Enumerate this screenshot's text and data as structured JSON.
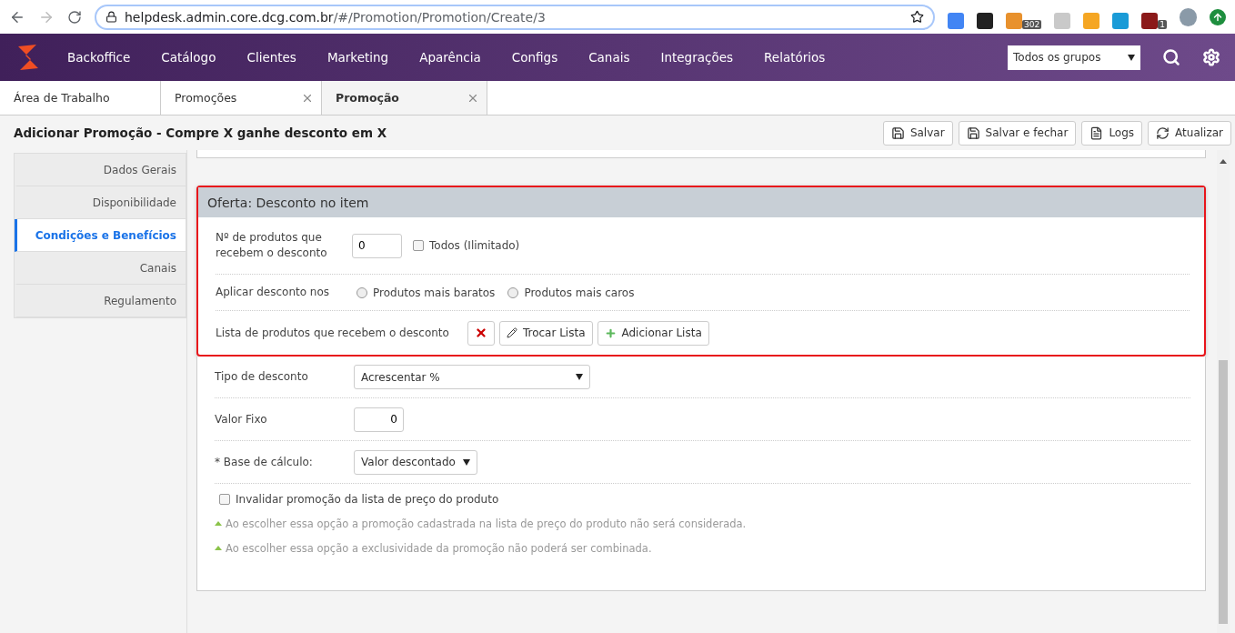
{
  "browser": {
    "url_host": "helpdesk.admin.core.dcg.com.br",
    "url_path": "/#/Promotion/Promotion/Create/3",
    "extensions": [
      {
        "color": "#4285f4"
      },
      {
        "color": "#222222"
      },
      {
        "color": "#e8912d",
        "badge": "302"
      },
      {
        "color": "#c9c9c9"
      },
      {
        "color": "#f5a623"
      },
      {
        "color": "#1a9bd7"
      },
      {
        "color": "#8b1a1a",
        "badge": "1"
      }
    ]
  },
  "nav": {
    "items": [
      "Backoffice",
      "Catálogo",
      "Clientes",
      "Marketing",
      "Aparência",
      "Configs",
      "Canais",
      "Integrações",
      "Relatórios"
    ],
    "group_select": "Todos os grupos"
  },
  "tabs": [
    {
      "label": "Área de Trabalho",
      "selected": false,
      "closable": false
    },
    {
      "label": "Promoções",
      "selected": false,
      "closable": true
    },
    {
      "label": "Promoção",
      "selected": true,
      "closable": true
    }
  ],
  "page": {
    "title": "Adicionar Promoção - Compre X ganhe desconto em X",
    "actions": [
      {
        "label": "Salvar",
        "kind": "save"
      },
      {
        "label": "Salvar e fechar",
        "kind": "save"
      },
      {
        "label": "Logs",
        "kind": "doc"
      },
      {
        "label": "Atualizar",
        "kind": "refresh"
      }
    ]
  },
  "sidebar": {
    "items": [
      {
        "label": "Dados Gerais",
        "selected": false
      },
      {
        "label": "Disponibilidade",
        "selected": false
      },
      {
        "label": "Condições e Benefícios",
        "selected": true
      },
      {
        "label": "Canais",
        "selected": false
      },
      {
        "label": "Regulamento",
        "selected": false
      }
    ]
  },
  "offer": {
    "title": "Oferta: Desconto no item",
    "highlighted": true,
    "rows": [
      {
        "kind": "count",
        "label": "Nº de produtos que recebem o desconto",
        "value": "0",
        "check_label": "Todos (Ilimitado)",
        "checked": false
      },
      {
        "kind": "radio",
        "label": "Aplicar desconto nos",
        "options": [
          {
            "label": "Produtos mais baratos",
            "selected": false
          },
          {
            "label": "Produtos mais caros",
            "selected": false
          }
        ]
      },
      {
        "kind": "list",
        "label": "Lista de produtos que recebem o desconto",
        "buttons": [
          {
            "kind": "remove"
          },
          {
            "kind": "change",
            "label": "Trocar Lista"
          },
          {
            "kind": "add",
            "label": "Adicionar Lista"
          }
        ]
      }
    ]
  },
  "fields": [
    {
      "kind": "select",
      "label": "Tipo de desconto",
      "value": "Acrescentar %",
      "wide": true
    },
    {
      "kind": "number",
      "label": "Valor Fixo",
      "value": "0"
    },
    {
      "kind": "select",
      "label": "* Base de cálculo:",
      "value": "Valor descontado",
      "wide": false
    }
  ],
  "invalidate": {
    "label": "Invalidar promoção da lista de preço do produto",
    "checked": false,
    "notes": [
      "Ao escolher essa opção a promoção cadastrada na lista de preço do produto não será considerada.",
      "Ao escolher essa opção a exclusividade da promoção não poderá ser combinada."
    ]
  }
}
